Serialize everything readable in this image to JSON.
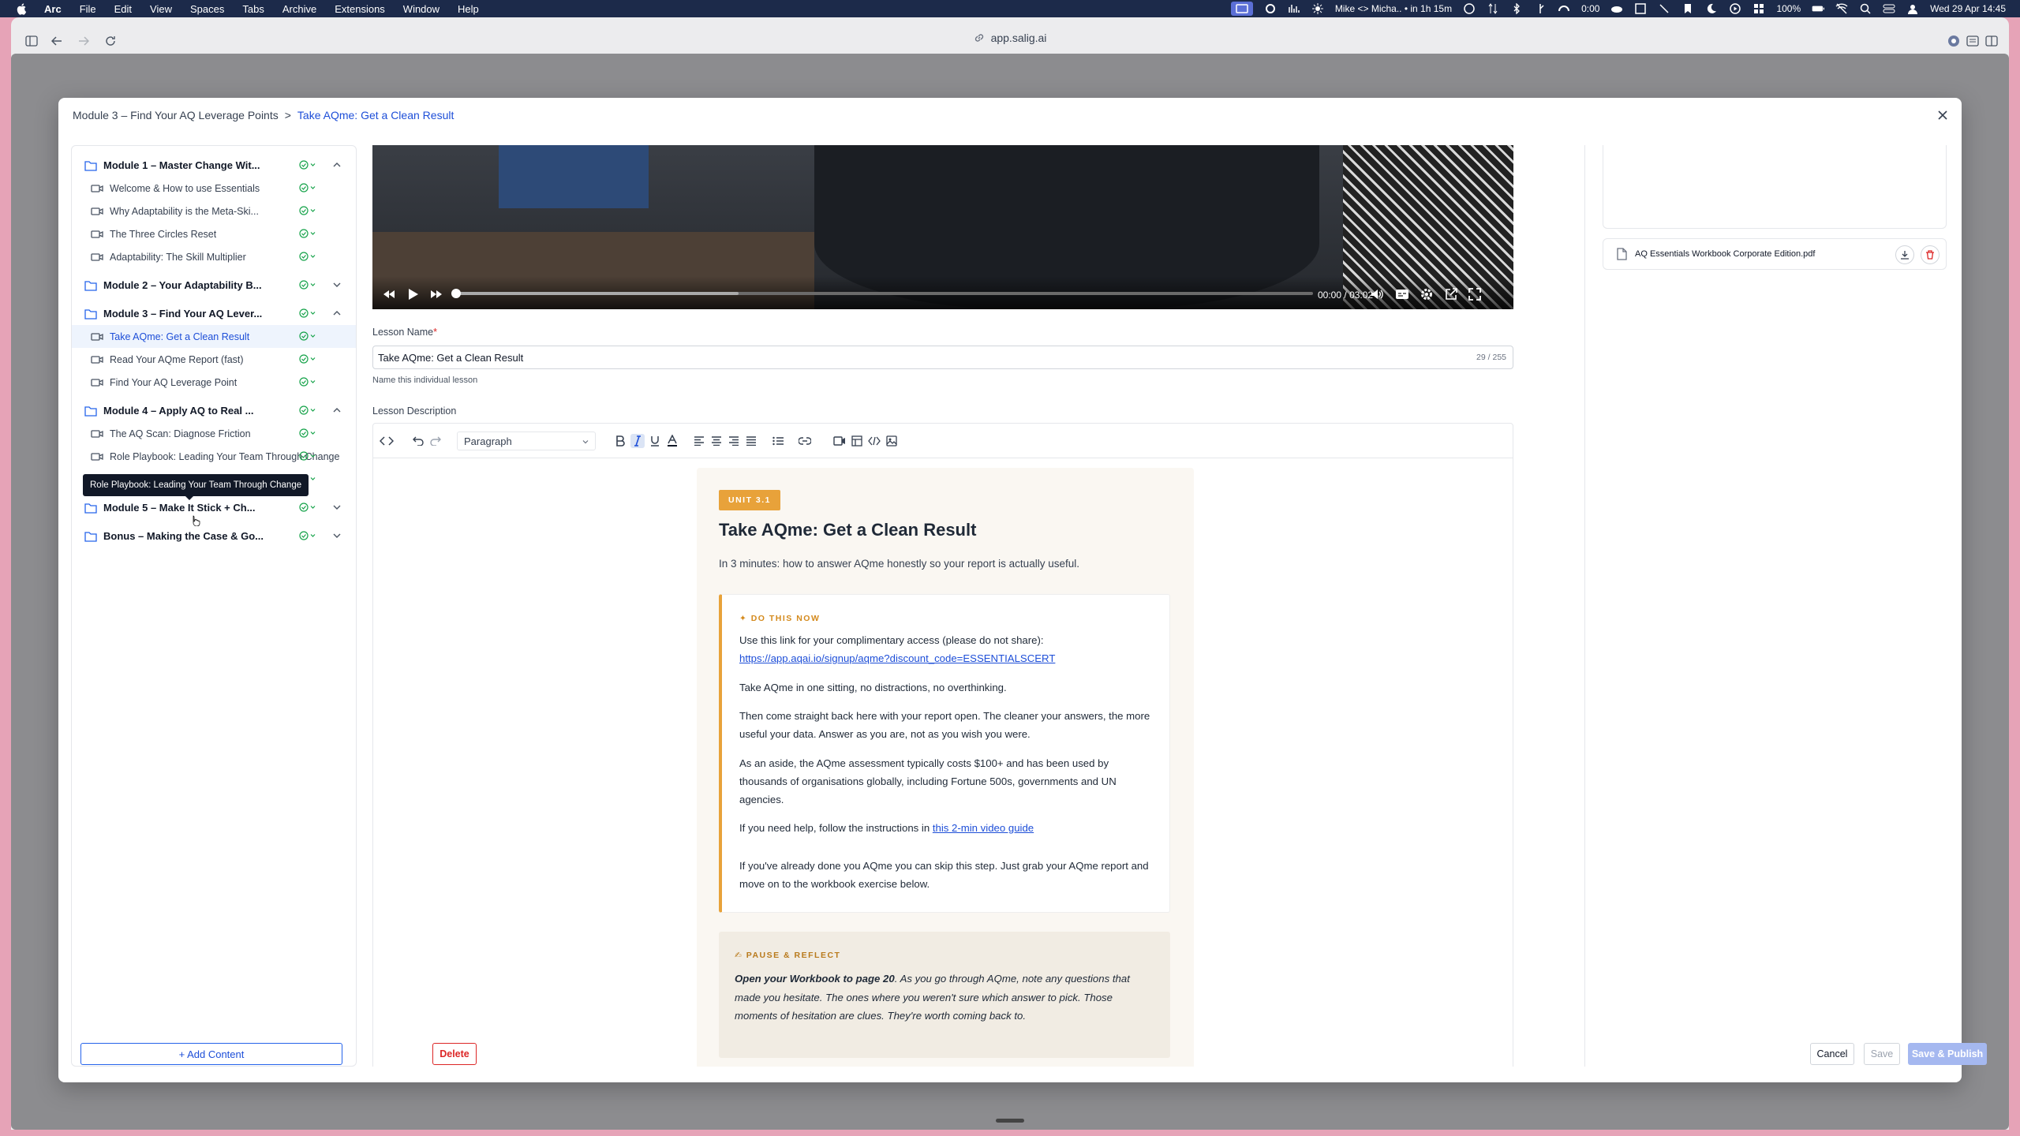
{
  "menubar": {
    "app_name": "Arc",
    "menus": [
      "File",
      "Edit",
      "View",
      "Spaces",
      "Tabs",
      "Archive",
      "Extensions",
      "Window",
      "Help"
    ],
    "meeting": "Mike <> Micha.. • in 1h 15m",
    "timer": "0:00",
    "battery": "100%",
    "datetime": "Wed 29 Apr  14:45"
  },
  "browser": {
    "url": "app.salig.ai"
  },
  "modal": {
    "breadcrumb": {
      "parent": "Module 3 – Find Your AQ Leverage Points",
      "separator": ">",
      "current": "Take AQme: Get a Clean Result"
    }
  },
  "tree": [
    {
      "type": "module",
      "label": "Module 1 – Master Change Wit...",
      "expanded": true
    },
    {
      "type": "lesson",
      "label": "Welcome & How to use Essentials"
    },
    {
      "type": "lesson",
      "label": "Why Adaptability is the Meta-Ski..."
    },
    {
      "type": "lesson",
      "label": "The Three Circles Reset"
    },
    {
      "type": "lesson",
      "label": "Adaptability: The Skill Multiplier"
    },
    {
      "type": "module",
      "label": "Module 2 – Your Adaptability B...",
      "expanded": false
    },
    {
      "type": "module",
      "label": "Module 3 – Find Your AQ Lever...",
      "expanded": true
    },
    {
      "type": "lesson",
      "label": "Take AQme: Get a Clean Result",
      "active": true
    },
    {
      "type": "lesson",
      "label": "Read Your AQme Report (fast)"
    },
    {
      "type": "lesson",
      "label": "Find Your AQ Leverage Point"
    },
    {
      "type": "module",
      "label": "Module 4 – Apply AQ to Real ...",
      "expanded": true
    },
    {
      "type": "lesson",
      "label": "The AQ Scan: Diagnose Friction"
    },
    {
      "type": "lesson",
      "label": "Role Playbook: Leading Your Team Through Change"
    },
    {
      "type": "lesson",
      "label": "Role Playbook: Leading Your Tea...",
      "hover": true
    },
    {
      "type": "module",
      "label": "Module 5 – Make It Stick + Ch...",
      "expanded": false
    },
    {
      "type": "module",
      "label": "Bonus – Making the Case & Go...",
      "expanded": false
    }
  ],
  "tooltip": "Role Playbook: Leading Your Team Through Change",
  "sidebar": {
    "add_content": "+ Add Content"
  },
  "video": {
    "current_time": "00:00",
    "separator": "/",
    "duration": "03:02",
    "played_fraction": 0,
    "buffered_fraction": 0.33
  },
  "lesson_name": {
    "label": "Lesson Name",
    "required_mark": "*",
    "value": "Take AQme: Get a Clean Result",
    "counter": "29 / 255",
    "helper": "Name this individual lesson"
  },
  "description": {
    "label": "Lesson Description",
    "block_format": "Paragraph",
    "unit_badge": "UNIT 3.1",
    "heading": "Take AQme: Get a Clean Result",
    "subtitle": "In 3 minutes: how to answer AQme honestly so your report is actually useful.",
    "callout_kicker": "✦ DO THIS NOW",
    "callout_p1": "Use this link for your complimentary access (please do not share):",
    "callout_link": "https://app.aqai.io/signup/aqme?discount_code=ESSENTIALSCERT",
    "callout_p2": "Take AQme in one sitting, no distractions, no overthinking.",
    "callout_p3": "Then come straight back here with your report open. The cleaner your answers, the more useful your data. Answer as you are, not as you wish you were.",
    "callout_p4": "As an aside, the AQme assessment typically costs $100+ and has been used by thousands of organisations globally, including Fortune 500s, governments and UN agencies.",
    "callout_p5_prefix": "If you need help, follow the instructions in",
    "callout_p5_link": "this 2-min video guide",
    "callout_p6": "If you've already done you AQme you can skip this step. Just grab your AQme report and move on to the workbook exercise below.",
    "reflect_kicker": "✍ PAUSE & REFLECT",
    "reflect_bold": "Open your Workbook to page 20",
    "reflect_text": ". As you go through AQme, note any questions that made you hesitate. The ones where you weren't sure which answer to pick. Those moments of hesitation are clues. They're worth coming back to."
  },
  "attachment": {
    "filename": "AQ Essentials Workbook Corporate Edition.pdf"
  },
  "actions": {
    "delete": "Delete",
    "cancel": "Cancel",
    "save": "Save",
    "publish": "Save & Publish"
  },
  "colors": {
    "accent": "#1d4ed8",
    "unit_badge": "#e8a23a",
    "danger": "#dc2626",
    "success": "#16a34a"
  }
}
